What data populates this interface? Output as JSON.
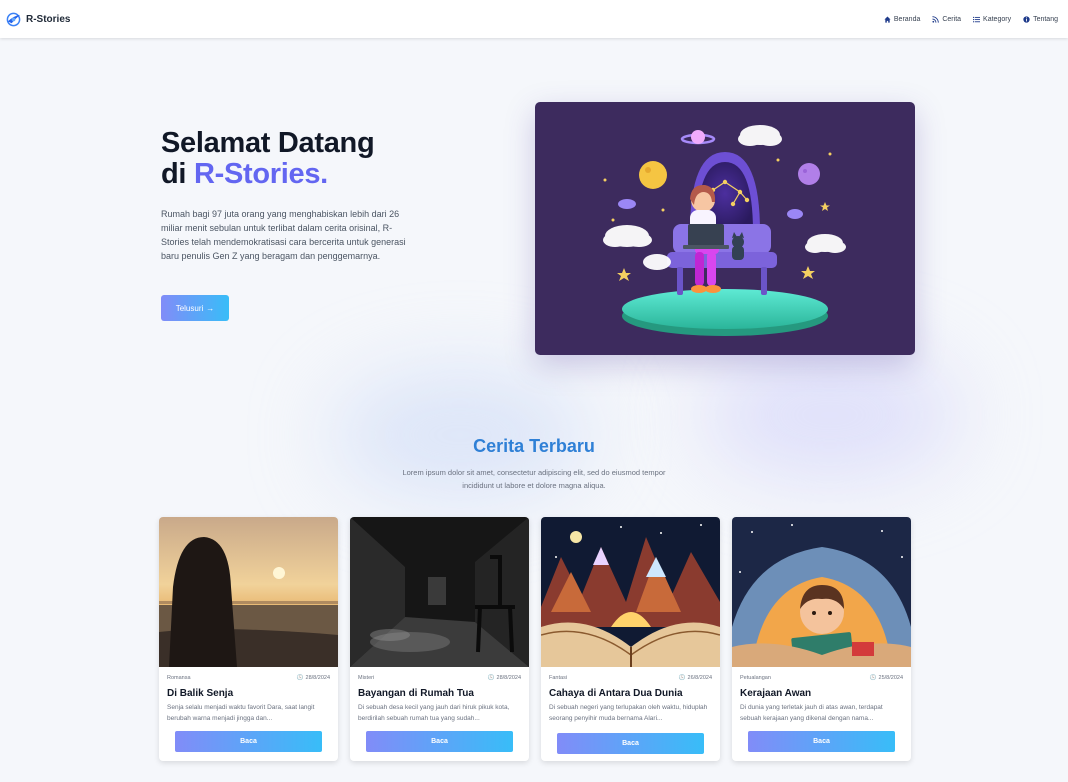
{
  "brand": {
    "name": "R-Stories"
  },
  "nav": {
    "items": [
      {
        "label": "Beranda",
        "icon": "home-icon"
      },
      {
        "label": "Cerita",
        "icon": "rss-icon"
      },
      {
        "label": "Kategory",
        "icon": "list-icon"
      },
      {
        "label": "Tentang",
        "icon": "info-icon"
      }
    ]
  },
  "hero": {
    "title_line1": "Selamat Datang",
    "title_prefix": "di ",
    "title_accent": "R-Stories.",
    "description": "Rumah bagi 97 juta orang yang menghabiskan lebih dari 26 miliar menit sebulan untuk terlibat dalam cerita orisinal, R-Stories telah mendemokratisasi cara bercerita untuk generasi baru penulis Gen Z yang beragam dan penggemarnya.",
    "cta_label": "Telusuri",
    "cta_icon": "arrow-right-icon"
  },
  "latest": {
    "title": "Cerita Terbaru",
    "subtitle": "Lorem ipsum dolor sit amet, consectetur adipiscing elit, sed do eiusmod tempor incididunt ut labore et dolore magna aliqua."
  },
  "stories": [
    {
      "category": "Romansa",
      "date": "28/8/2024",
      "title": "Di Balik Senja",
      "excerpt": "Senja selalu menjadi waktu favorit Dara, saat langit berubah warna menjadi jingga dan...",
      "button": "Baca"
    },
    {
      "category": "Misteri",
      "date": "28/8/2024",
      "title": "Bayangan di Rumah Tua",
      "excerpt": "Di sebuah desa kecil yang jauh dari hiruk pikuk kota, berdirilah sebuah rumah tua yang sudah...",
      "button": "Baca"
    },
    {
      "category": "Fantasi",
      "date": "26/8/2024",
      "title": "Cahaya di Antara Dua Dunia",
      "excerpt": "Di sebuah negeri yang terlupakan oleh waktu, hiduplah seorang penyihir muda bernama Alari...",
      "button": "Baca"
    },
    {
      "category": "Petualangan",
      "date": "25/8/2024",
      "title": "Kerajaan Awan",
      "excerpt": "Di dunia yang terletak jauh di atas awan, terdapat sebuah kerajaan yang dikenal dengan nama...",
      "button": "Baca"
    }
  ],
  "colors": {
    "accent": "#6366f1",
    "section_title": "#2f80d6",
    "gradient_start": "#818cf8",
    "gradient_end": "#38bdf8"
  }
}
